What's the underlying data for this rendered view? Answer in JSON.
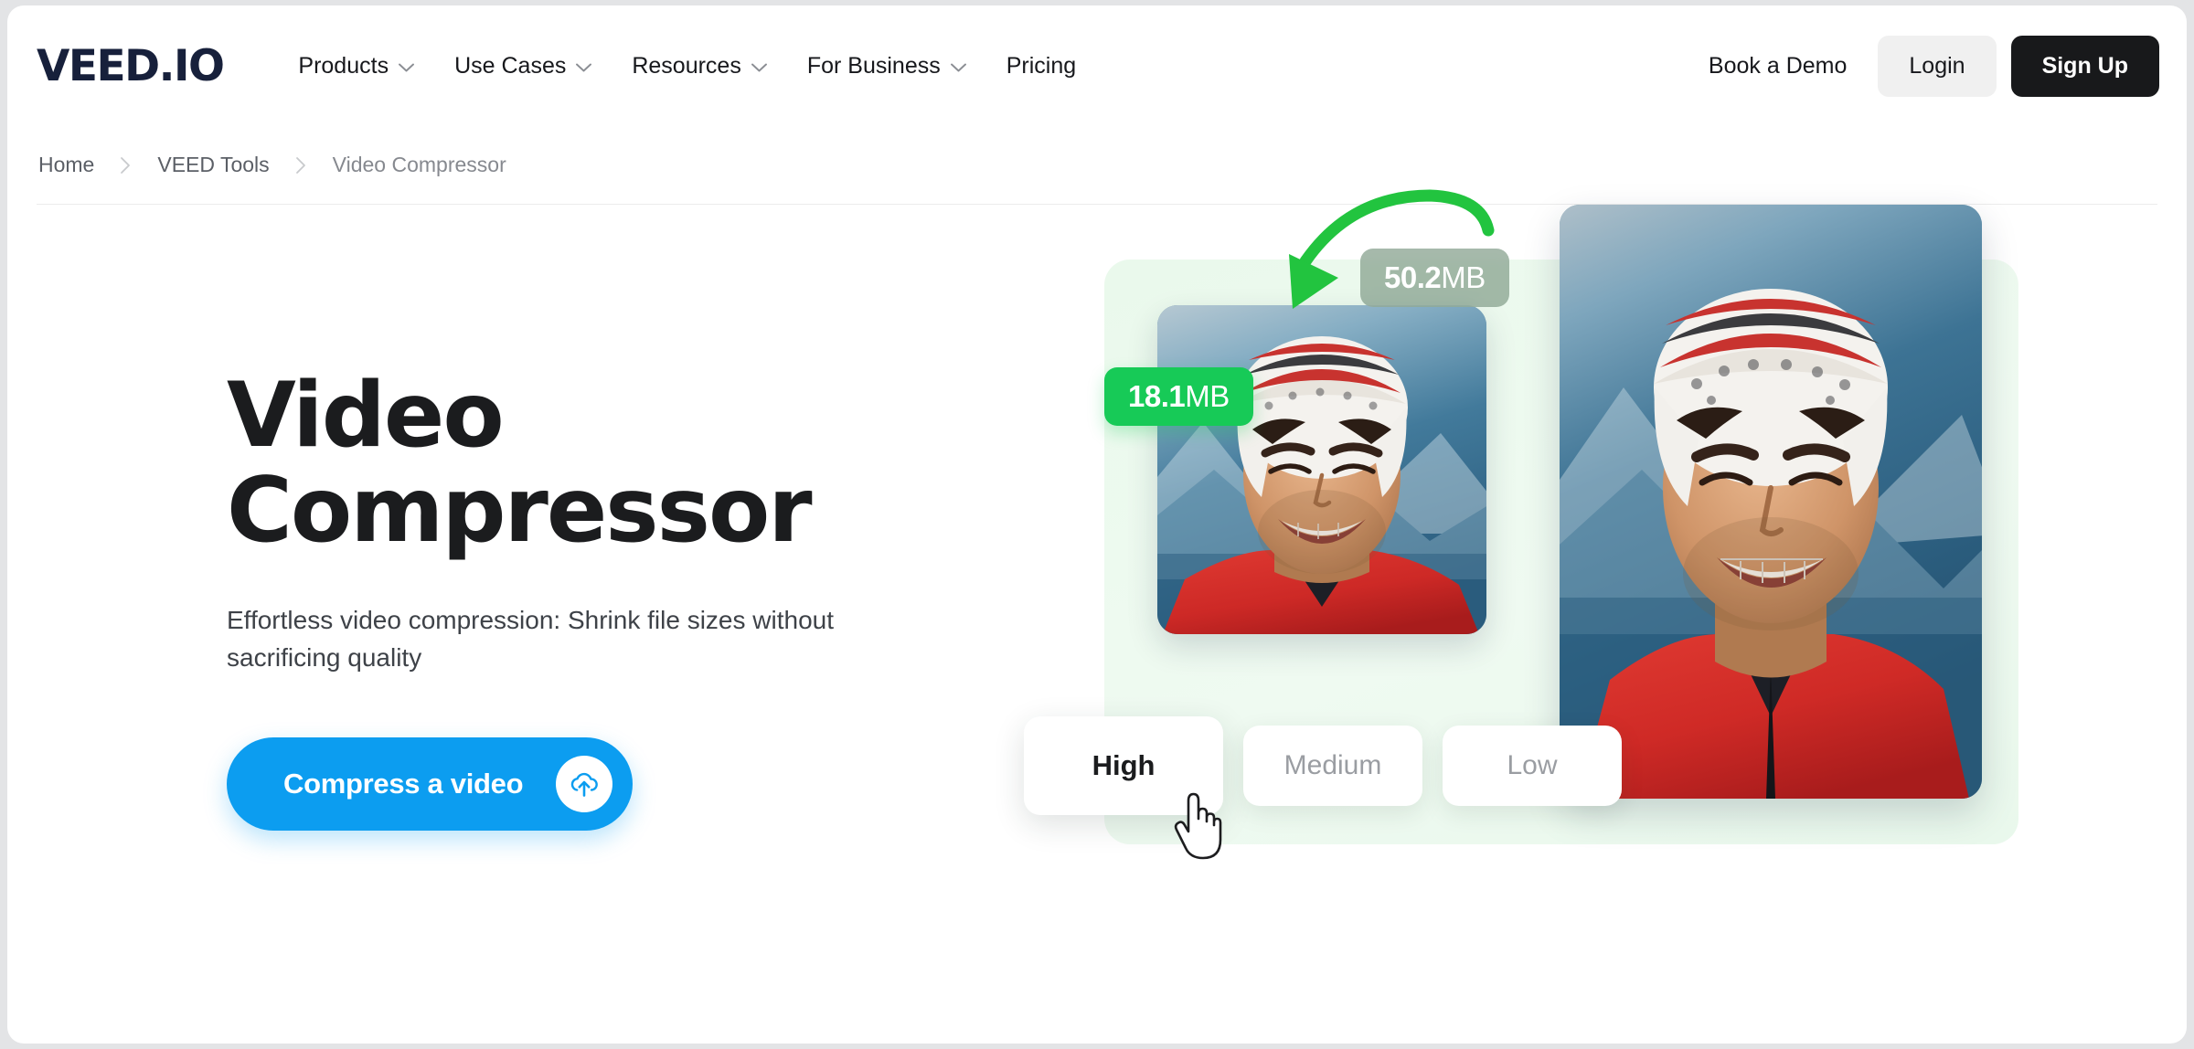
{
  "header": {
    "logo": "VEED.IO",
    "nav": [
      {
        "label": "Products",
        "has_chevron": true
      },
      {
        "label": "Use Cases",
        "has_chevron": true
      },
      {
        "label": "Resources",
        "has_chevron": true
      },
      {
        "label": "For Business",
        "has_chevron": true
      },
      {
        "label": "Pricing",
        "has_chevron": false
      }
    ],
    "demo_link": "Book a Demo",
    "login_label": "Login",
    "signup_label": "Sign Up"
  },
  "breadcrumb": {
    "items": [
      {
        "label": "Home"
      },
      {
        "label": "VEED Tools"
      },
      {
        "label": "Video Compressor"
      }
    ],
    "separator": "›"
  },
  "hero": {
    "title_line1": "Video",
    "title_line2": "Compressor",
    "subtitle": "Effortless video compression: Shrink file sizes without sacrificing quality",
    "cta_label": "Compress a video",
    "cta_icon": "cloud-upload-icon"
  },
  "illustration": {
    "compressed_badge": {
      "value": "18.1",
      "unit": "MB"
    },
    "original_badge": {
      "value": "50.2",
      "unit": "MB"
    },
    "arrow_icon": "curved-green-arrow-icon",
    "cursor_icon": "pointing-hand-cursor-icon",
    "quality_options": [
      {
        "label": "High",
        "selected": true
      },
      {
        "label": "Medium",
        "selected": false
      },
      {
        "label": "Low",
        "selected": false
      }
    ]
  },
  "colors": {
    "brand_navy": "#17203b",
    "cta_blue": "#0c9df0",
    "badge_green": "#17ca57",
    "badge_gray": "#839e8b",
    "signup_black": "#18191b",
    "mint_panel": "#eaf9ec"
  }
}
